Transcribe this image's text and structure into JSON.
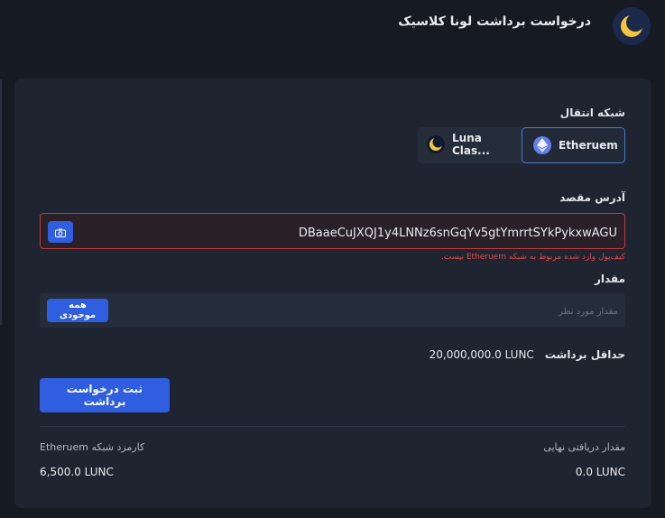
{
  "header": {
    "title": "درخواست برداشت لونا کلاسیک",
    "logo_icon": "luna-moon-icon"
  },
  "network": {
    "label": "شبکه انتقال",
    "options": [
      {
        "name": "Etheruem",
        "icon": "ethereum-icon",
        "selected": true
      },
      {
        "name": "Luna Clas...",
        "icon": "luna-moon-icon",
        "selected": false
      }
    ]
  },
  "address": {
    "label": "آدرس مقصد",
    "value": "DBaaeCuJXQJ1y4LNNz6snGqYv5gtYmrrtSYkPykxwAGU",
    "error": "کیف‌پول وارد شده مربوط به شبکه Etheruem نیست."
  },
  "amount": {
    "label": "مقدار",
    "placeholder": "مقدار مورد نظر",
    "all_button": "همه موجودی"
  },
  "min_withdraw": {
    "label": "حداقل برداشت",
    "value": "20,000,000.0 LUNC"
  },
  "submit_label": "ثبت درخواست برداشت",
  "fees": {
    "final_label": "مقدار دریافتی نهایی",
    "final_value": "0.0 LUNC",
    "network_fee_label": "کارمزد شبکه Etheruem",
    "network_fee_value": "6,500.0 LUNC"
  },
  "colors": {
    "accent": "#2f5fe0",
    "error": "#e34a4a",
    "card": "#1e2430",
    "background": "#151a23"
  }
}
